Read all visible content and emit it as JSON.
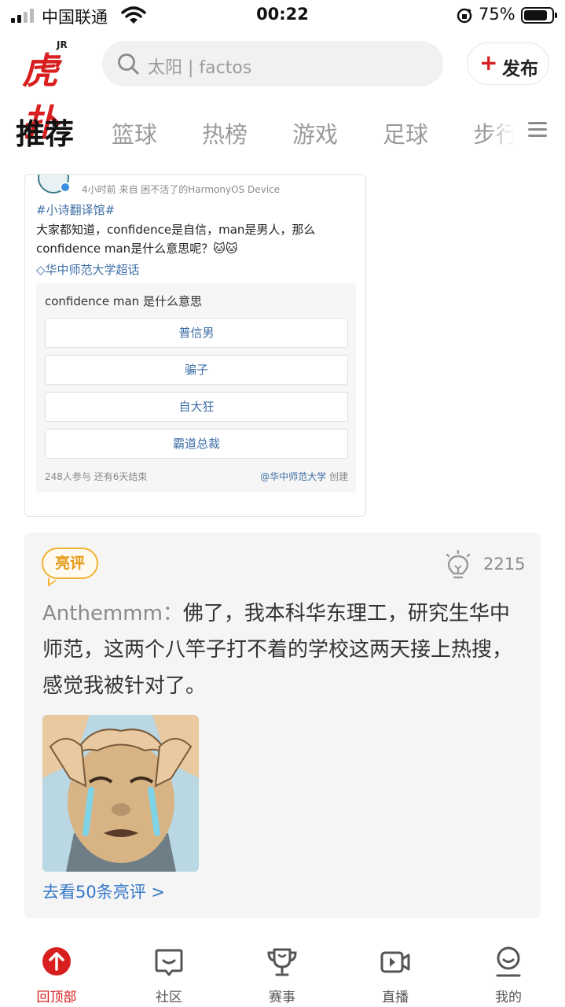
{
  "status_bar": {
    "carrier": "中国联通",
    "time": "00:22",
    "battery": "75%"
  },
  "header": {
    "logo_text": "虎扑",
    "logo_sup": "JR",
    "search_placeholder": "太阳 | factos",
    "publish_label": "发布"
  },
  "tabs": [
    {
      "label": "推荐",
      "active": true
    },
    {
      "label": "篮球"
    },
    {
      "label": "热榜"
    },
    {
      "label": "游戏"
    },
    {
      "label": "足球"
    },
    {
      "label": "步行"
    }
  ],
  "weibo_post": {
    "meta": "4小时前  来自 困不活了的HarmonyOS Device",
    "topic": "#小诗翻译馆#",
    "text": "大家都知道，confidence是自信，man是男人，那么confidence man是什么意思呢？🐱🐱",
    "super_topic": "华中师范大学超话",
    "poll": {
      "question": "confidence man 是什么意思",
      "options": [
        "普信男",
        "骗子",
        "自大狂",
        "霸道总裁"
      ],
      "participants": "248人参与  还有6天结束",
      "creator_link": "@华中师范大学",
      "creator_suffix": " 创建"
    }
  },
  "highlight_comment": {
    "badge": "亮评",
    "likes": "2215",
    "username": "Anthemmm：",
    "text": "佛了，我本科华东理工，研究生华中师范，这两个八竿子打不着的学校这两天接上热搜，感觉我被针对了。",
    "more_link": "去看50条亮评 >"
  },
  "bottom_nav": [
    {
      "label": "回顶部",
      "icon": "back-to-top-icon",
      "active": true
    },
    {
      "label": "社区",
      "icon": "community-icon"
    },
    {
      "label": "赛事",
      "icon": "trophy-icon"
    },
    {
      "label": "直播",
      "icon": "live-icon"
    },
    {
      "label": "我的",
      "icon": "profile-icon"
    }
  ],
  "colors": {
    "brand_red": "#d81e1e",
    "link_blue": "#3778c8",
    "badge_orange": "#e59a15"
  }
}
